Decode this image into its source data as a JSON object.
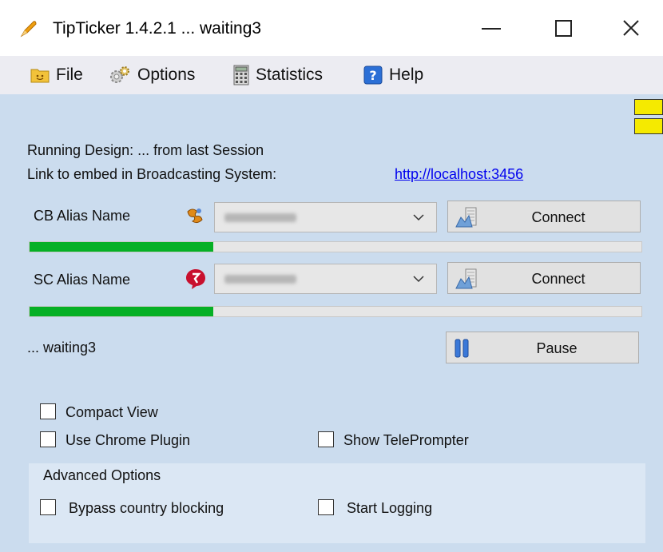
{
  "window": {
    "title": "TipTicker 1.4.2.1 ... waiting3",
    "minimize_icon": "minimize-icon",
    "maximize_icon": "maximize-icon",
    "close_icon": "close-icon"
  },
  "menu": {
    "items": [
      {
        "label": "File",
        "icon": "folder-smile-icon"
      },
      {
        "label": "Options",
        "icon": "gears-icon"
      },
      {
        "label": "Statistics",
        "icon": "calculator-icon"
      },
      {
        "label": "Help",
        "icon": "help-icon"
      }
    ]
  },
  "info": {
    "running_design": "Running Design: ... from last Session",
    "link_label": "Link to embed in Broadcasting System:",
    "link_url": "http://localhost:3456"
  },
  "cb": {
    "label": "CB Alias Name",
    "icon": "cb-service-icon",
    "alias_value": "",
    "connect_label": "Connect",
    "connect_icon": "connect-icon",
    "progress": 0.3
  },
  "sc": {
    "label": "SC Alias Name",
    "icon": "sc-service-icon",
    "alias_value": "",
    "connect_label": "Connect",
    "connect_icon": "connect-icon",
    "progress": 0.3
  },
  "status": "... waiting3",
  "pause": {
    "label": "Pause",
    "icon": "pause-icon"
  },
  "options": {
    "compact_view": {
      "label": "Compact View",
      "checked": false
    },
    "use_chrome_plugin": {
      "label": "Use Chrome Plugin",
      "checked": false
    },
    "show_teleprompter": {
      "label": "Show TelePrompter",
      "checked": false
    }
  },
  "advanced": {
    "title": "Advanced Options",
    "bypass_country_blocking": {
      "label": "Bypass country blocking",
      "checked": false
    },
    "start_logging": {
      "label": "Start Logging",
      "checked": false
    }
  },
  "colors": {
    "background": "#cbdcee",
    "progress_fill": "#06b025",
    "indicator": "#f5ea00",
    "link": "#0000ee"
  }
}
